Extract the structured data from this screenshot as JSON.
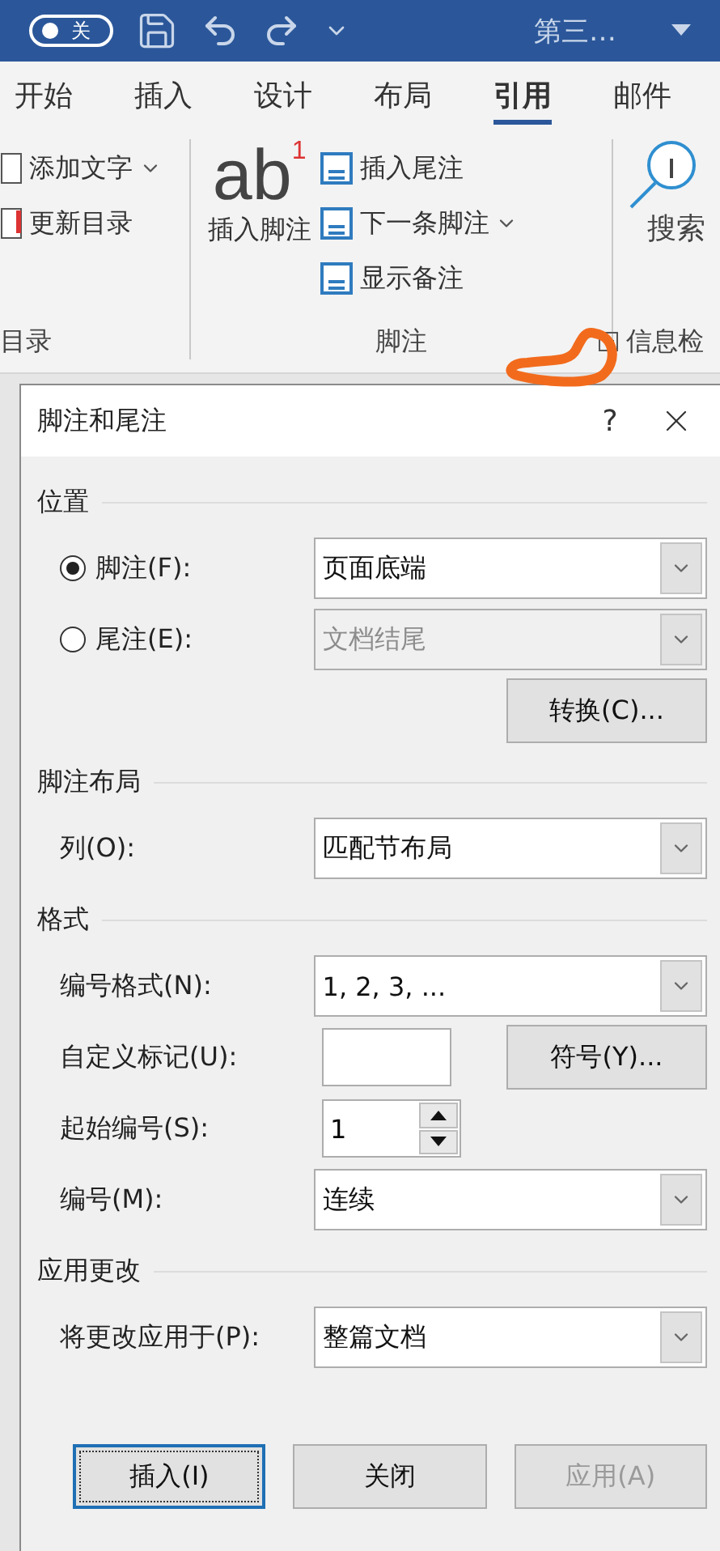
{
  "title_bar": {
    "autosave": {
      "label": "关",
      "on": false
    },
    "doc_title": "第三…"
  },
  "ribbon_tabs": [
    {
      "label": "开始",
      "selected": false
    },
    {
      "label": "插入",
      "selected": false
    },
    {
      "label": "设计",
      "selected": false
    },
    {
      "label": "布局",
      "selected": false
    },
    {
      "label": "引用",
      "selected": true
    },
    {
      "label": "邮件",
      "selected": false
    }
  ],
  "ribbon": {
    "toc_group": {
      "items": [
        {
          "label": "添加文字",
          "caret": true
        },
        {
          "label": "更新目录",
          "caret": false
        }
      ],
      "label": "目录"
    },
    "footnote_group": {
      "big_button": {
        "icon_text": "ab$^{1}$",
        "label": "插入脚注"
      },
      "items": [
        {
          "label": "插入尾注",
          "caret": false
        },
        {
          "label": "下一条脚注",
          "caret": true
        },
        {
          "label": "显示备注",
          "caret": false
        }
      ],
      "label": "脚注"
    },
    "research_group": {
      "button": {
        "label": "搜索"
      },
      "label": "信息检"
    }
  },
  "annotation": {
    "kind": "circle"
  },
  "dialog": {
    "title": "脚注和尾注",
    "help": "?",
    "sections": [
      {
        "heading": "位置",
        "rows": [
          {
            "kind": "radio_select",
            "label": "脚注(F):",
            "selected": true,
            "value": "页面底端",
            "disabled": false
          },
          {
            "kind": "radio_select",
            "label": "尾注(E):",
            "selected": false,
            "value": "文档结尾",
            "disabled": true
          },
          {
            "kind": "button",
            "button": "转换(C)..."
          }
        ]
      },
      {
        "heading": "脚注布局",
        "rows": [
          {
            "kind": "select",
            "label": "列(O):",
            "value": "匹配节布局"
          }
        ]
      },
      {
        "heading": "格式",
        "rows": [
          {
            "kind": "select",
            "label": "编号格式(N):",
            "value": "1, 2, 3, ..."
          },
          {
            "kind": "text_button",
            "label": "自定义标记(U):",
            "button": "符号(Y)..."
          },
          {
            "kind": "spinner",
            "label": "起始编号(S):",
            "value": "1"
          },
          {
            "kind": "select",
            "label": "编号(M):",
            "value": "连续"
          }
        ]
      },
      {
        "heading": "应用更改",
        "rows": [
          {
            "kind": "select",
            "label": "将更改应用于(P):",
            "value": "整篇文档"
          }
        ]
      }
    ],
    "buttons": [
      {
        "label": "插入(I)",
        "default": true,
        "disabled": false
      },
      {
        "label": "关闭",
        "default": false,
        "disabled": false
      },
      {
        "label": "应用(A)",
        "default": false,
        "disabled": true
      }
    ]
  }
}
